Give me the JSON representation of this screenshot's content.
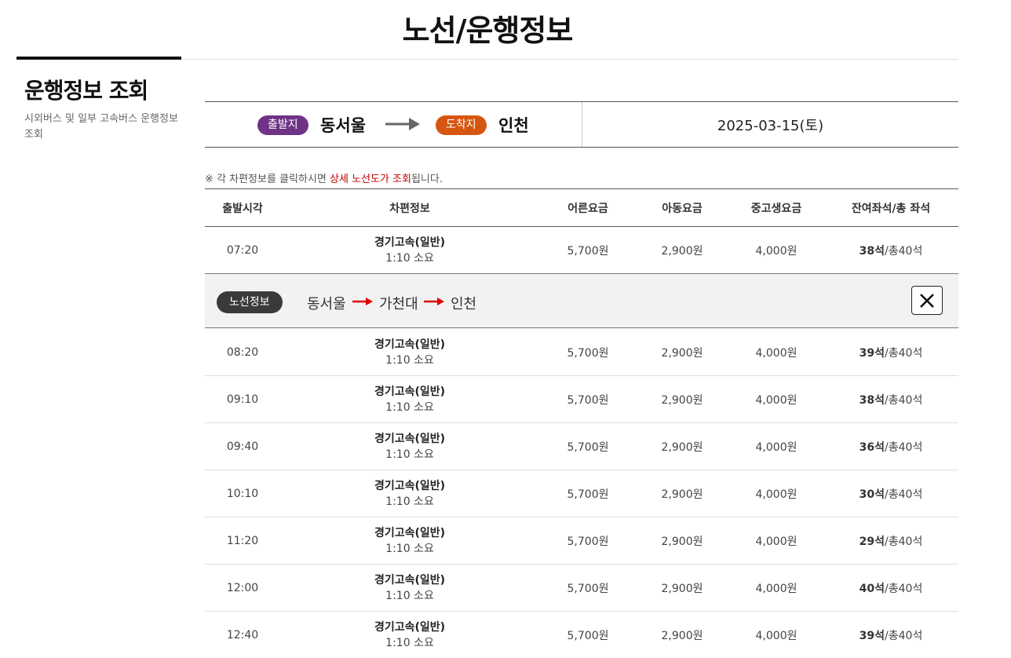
{
  "header": {
    "title": "노선/운행정보"
  },
  "side": {
    "title": "운행정보 조회",
    "description": "시외버스 및 일부 고속버스 운행정보 조회"
  },
  "route": {
    "departure_label": "출발지",
    "departure": "동서울",
    "arrival_label": "도착지",
    "arrival": "인천",
    "date": "2025-03-15(토)"
  },
  "notice": {
    "prefix": "※ 각 차편정보를 클릭하시면 ",
    "highlight": "상세 노선도가 조회",
    "suffix": "됩니다."
  },
  "table": {
    "headers": [
      "출발시각",
      "차편정보",
      "어른요금",
      "아동요금",
      "중고생요금",
      "잔여좌석/총 좌석"
    ],
    "rows": [
      {
        "time": "07:20",
        "bus": "경기고속(일반)",
        "duration": "1:10 소요",
        "adult": "5,700원",
        "child": "2,900원",
        "youth": "4,000원",
        "remaining": "38석",
        "total": "/총40석"
      },
      {
        "time": "08:20",
        "bus": "경기고속(일반)",
        "duration": "1:10 소요",
        "adult": "5,700원",
        "child": "2,900원",
        "youth": "4,000원",
        "remaining": "39석",
        "total": "/총40석"
      },
      {
        "time": "09:10",
        "bus": "경기고속(일반)",
        "duration": "1:10 소요",
        "adult": "5,700원",
        "child": "2,900원",
        "youth": "4,000원",
        "remaining": "38석",
        "total": "/총40석"
      },
      {
        "time": "09:40",
        "bus": "경기고속(일반)",
        "duration": "1:10 소요",
        "adult": "5,700원",
        "child": "2,900원",
        "youth": "4,000원",
        "remaining": "36석",
        "total": "/총40석"
      },
      {
        "time": "10:10",
        "bus": "경기고속(일반)",
        "duration": "1:10 소요",
        "adult": "5,700원",
        "child": "2,900원",
        "youth": "4,000원",
        "remaining": "30석",
        "total": "/총40석"
      },
      {
        "time": "11:20",
        "bus": "경기고속(일반)",
        "duration": "1:10 소요",
        "adult": "5,700원",
        "child": "2,900원",
        "youth": "4,000원",
        "remaining": "29석",
        "total": "/총40석"
      },
      {
        "time": "12:00",
        "bus": "경기고속(일반)",
        "duration": "1:10 소요",
        "adult": "5,700원",
        "child": "2,900원",
        "youth": "4,000원",
        "remaining": "40석",
        "total": "/총40석"
      },
      {
        "time": "12:40",
        "bus": "경기고속(일반)",
        "duration": "1:10 소요",
        "adult": "5,700원",
        "child": "2,900원",
        "youth": "4,000원",
        "remaining": "39석",
        "total": "/총40석"
      }
    ]
  },
  "route_detail": {
    "label": "노선정보",
    "stops": [
      "동서울",
      "가천대",
      "인천"
    ],
    "close_icon": "close-icon"
  },
  "colors": {
    "departure_badge": "#6f3386",
    "arrival_badge": "#d6560f",
    "highlight": "#c40000",
    "route_arrow": "#e00000"
  }
}
